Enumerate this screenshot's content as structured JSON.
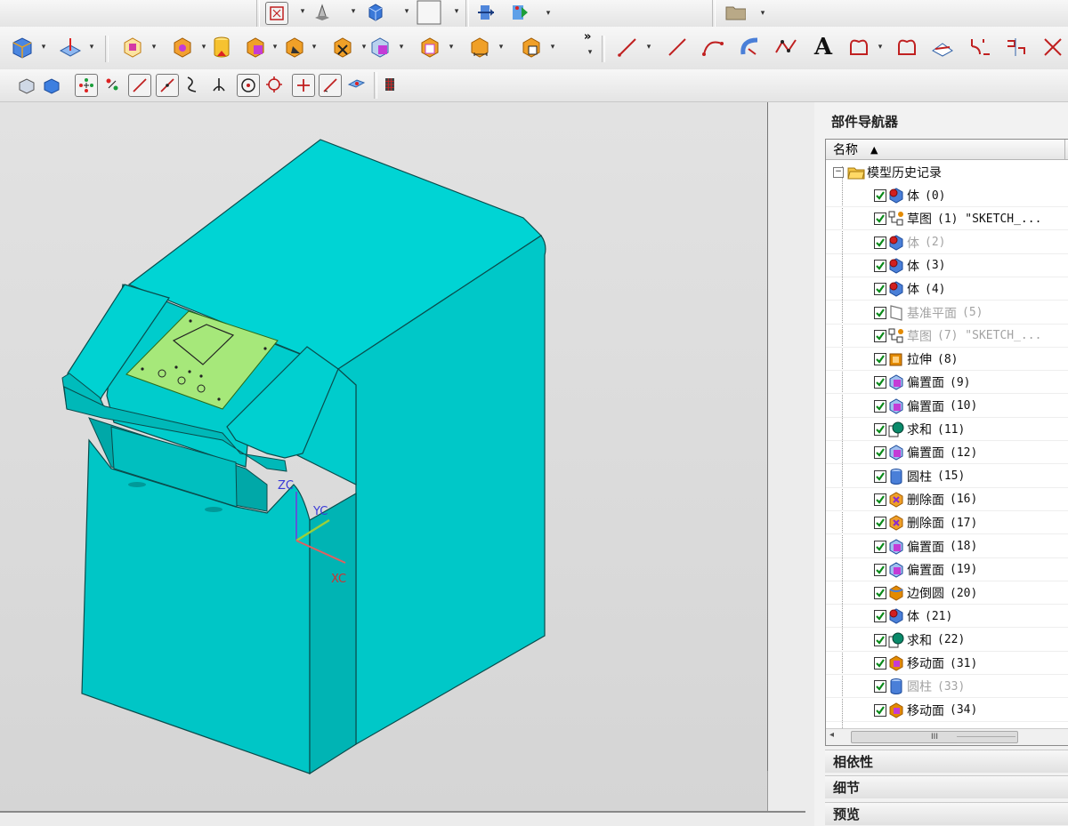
{
  "panel": {
    "title": "部件导航器",
    "column_header": "名称",
    "sort_indicator": "▲",
    "root": "模型历史记录",
    "items": [
      {
        "label": "体",
        "index": "(0)",
        "dim": false,
        "icon": "body-icon",
        "color": "#d21f1f"
      },
      {
        "label": "草图",
        "index": "(1) \"SKETCH_...",
        "dim": false,
        "icon": "sketch-icon",
        "color": "#e38a00"
      },
      {
        "label": "体",
        "index": "(2)",
        "dim": true,
        "icon": "body-icon",
        "color": "#d21f1f"
      },
      {
        "label": "体",
        "index": "(3)",
        "dim": false,
        "icon": "body-icon",
        "color": "#d21f1f"
      },
      {
        "label": "体",
        "index": "(4)",
        "dim": false,
        "icon": "body-icon",
        "color": "#d21f1f"
      },
      {
        "label": "基准平面",
        "index": "(5)",
        "dim": true,
        "icon": "datum-plane-icon",
        "color": "#777777"
      },
      {
        "label": "草图",
        "index": "(7) \"SKETCH_...",
        "dim": true,
        "icon": "sketch-icon",
        "color": "#e38a00"
      },
      {
        "label": "拉伸",
        "index": "(8)",
        "dim": false,
        "icon": "extrude-icon",
        "color": "#e38a00"
      },
      {
        "label": "偏置面",
        "index": "(9)",
        "dim": false,
        "icon": "offset-face-icon",
        "color": "#c43bd6"
      },
      {
        "label": "偏置面",
        "index": "(10)",
        "dim": false,
        "icon": "offset-face-icon",
        "color": "#c43bd6"
      },
      {
        "label": "求和",
        "index": "(11)",
        "dim": false,
        "icon": "unite-icon",
        "color": "#0a8a6a"
      },
      {
        "label": "偏置面",
        "index": "(12)",
        "dim": false,
        "icon": "offset-face-icon",
        "color": "#c43bd6"
      },
      {
        "label": "圆柱",
        "index": "(15)",
        "dim": false,
        "icon": "cylinder-icon",
        "color": "#4a7fd8"
      },
      {
        "label": "删除面",
        "index": "(16)",
        "dim": false,
        "icon": "delete-face-icon",
        "color": "#e38a00"
      },
      {
        "label": "删除面",
        "index": "(17)",
        "dim": false,
        "icon": "delete-face-icon",
        "color": "#e38a00"
      },
      {
        "label": "偏置面",
        "index": "(18)",
        "dim": false,
        "icon": "offset-face-icon",
        "color": "#c43bd6"
      },
      {
        "label": "偏置面",
        "index": "(19)",
        "dim": false,
        "icon": "offset-face-icon",
        "color": "#c43bd6"
      },
      {
        "label": "边倒圆",
        "index": "(20)",
        "dim": false,
        "icon": "edge-blend-icon",
        "color": "#e38a00"
      },
      {
        "label": "体",
        "index": "(21)",
        "dim": false,
        "icon": "body-icon",
        "color": "#d21f1f"
      },
      {
        "label": "求和",
        "index": "(22)",
        "dim": false,
        "icon": "unite-icon",
        "color": "#0a8a6a"
      },
      {
        "label": "移动面",
        "index": "(31)",
        "dim": false,
        "icon": "move-face-icon",
        "color": "#e38a00"
      },
      {
        "label": "圆柱",
        "index": "(33)",
        "dim": true,
        "icon": "cylinder-icon",
        "color": "#4a7fd8"
      },
      {
        "label": "移动面",
        "index": "(34)",
        "dim": false,
        "icon": "move-face-icon",
        "color": "#e38a00"
      }
    ],
    "scroll_thumb": "III",
    "scroll_left": "◂",
    "sections": [
      "相依性",
      "细节",
      "预览"
    ]
  },
  "viewport": {
    "axis_x": "XC",
    "axis_y": "YC",
    "axis_z": "ZC",
    "model_color": "#00cdcd",
    "panel_color": "#a6e87a"
  },
  "toolbar": {
    "text_tool": "A",
    "overflow": "»"
  }
}
